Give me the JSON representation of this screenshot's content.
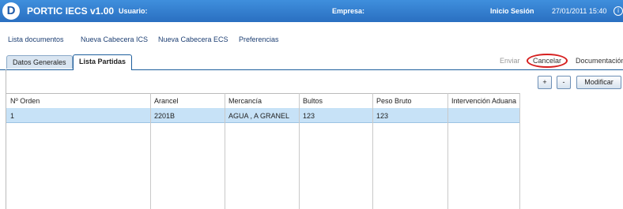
{
  "header": {
    "logo": "D",
    "title": "PORTIC IECS v1.00",
    "user_label": "Usuario:",
    "company_label": "Empresa:",
    "session_label": "Inicio Sesión",
    "session_datetime": "27/01/2011 15:40",
    "info_icon": "i"
  },
  "menu": {
    "items": [
      "Lista documentos",
      "Nueva Cabecera ICS",
      "Nueva Cabecera ECS",
      "Preferencias"
    ]
  },
  "tabs": {
    "items": [
      "Datos Generales",
      "Lista Partidas"
    ],
    "active": "Lista Partidas"
  },
  "actions": {
    "send": "Enviar",
    "cancel": "Cancelar",
    "docs": "Documentación"
  },
  "buttons": {
    "add": "+",
    "remove": "-",
    "modify": "Modificar"
  },
  "table": {
    "columns": [
      "Nº Orden",
      "Arancel",
      "Mercancía",
      "Bultos",
      "Peso Bruto",
      "Intervención Aduana"
    ],
    "rows": [
      [
        "1",
        "2201B",
        "AGUA , A GRANEL",
        "123",
        "123",
        ""
      ]
    ]
  },
  "colors": {
    "header_bg": "#2a6fc1",
    "selected_row": "#c7e2f7",
    "highlight_circle": "#d62020"
  }
}
